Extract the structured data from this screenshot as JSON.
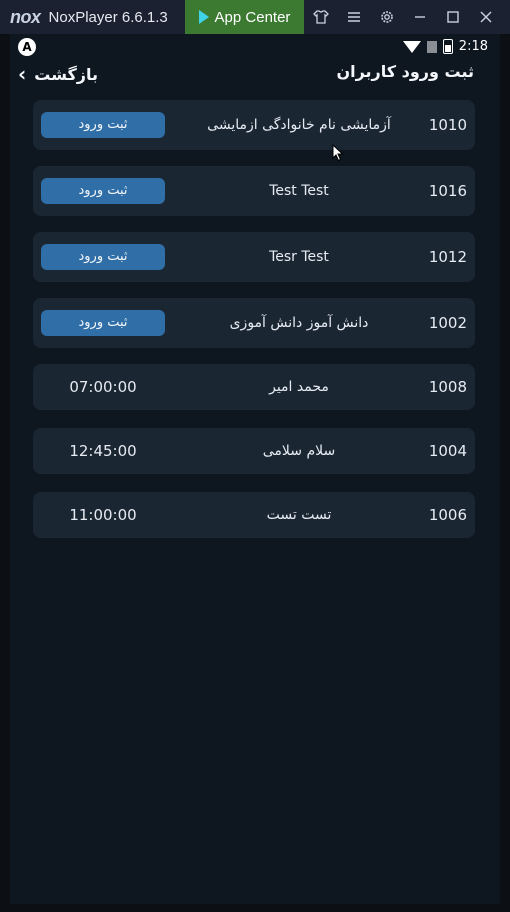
{
  "window": {
    "logo": "nox",
    "title": "NoxPlayer 6.6.1.3",
    "app_center": "App Center",
    "icons": [
      "shirt-icon",
      "menu-icon",
      "gear-icon",
      "minimize-icon",
      "maximize-icon",
      "close-icon"
    ]
  },
  "status": {
    "badge": "A",
    "time": "2:18"
  },
  "header": {
    "back_label": "بازگشت",
    "title": "ثبت ورود کاربران"
  },
  "users": [
    {
      "id": "1010",
      "name": "آزمایشی نام خانوادگی ازمایشی",
      "action": "ثبت ورود",
      "time": null
    },
    {
      "id": "1016",
      "name": "Test Test",
      "action": "ثبت ورود",
      "time": null
    },
    {
      "id": "1012",
      "name": "Tesr Test",
      "action": "ثبت ورود",
      "time": null
    },
    {
      "id": "1002",
      "name": "دانش آموز دانش آموزی",
      "action": "ثبت ورود",
      "time": null
    },
    {
      "id": "1008",
      "name": "محمد امیر",
      "action": null,
      "time": "07:00:00"
    },
    {
      "id": "1004",
      "name": "سلام سلامی",
      "action": null,
      "time": "12:45:00"
    },
    {
      "id": "1006",
      "name": "تست تست",
      "action": null,
      "time": "11:00:00"
    }
  ],
  "colors": {
    "background": "#0e1620",
    "card": "#1b2633",
    "button": "#2f6ea6",
    "titlebar": "#1b2130",
    "app_center": "#3c7a32"
  }
}
